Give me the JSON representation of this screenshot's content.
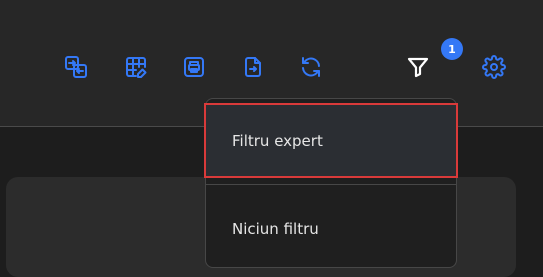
{
  "colors": {
    "accent": "#3478f6",
    "highlight_outline": "#d93a3a",
    "toolbar_bg": "#272727",
    "menu_bg": "#1f1f1f"
  },
  "toolbar": {
    "icons": [
      "swap-tables-icon",
      "grid-edit-icon",
      "print-icon",
      "export-file-icon",
      "refresh-icon",
      "filter-icon",
      "settings-icon"
    ],
    "filter_badge": "1"
  },
  "filter_menu": {
    "items": [
      {
        "label": "Filtru expert",
        "highlighted": true
      },
      {
        "label": "Niciun filtru",
        "highlighted": false
      }
    ]
  }
}
